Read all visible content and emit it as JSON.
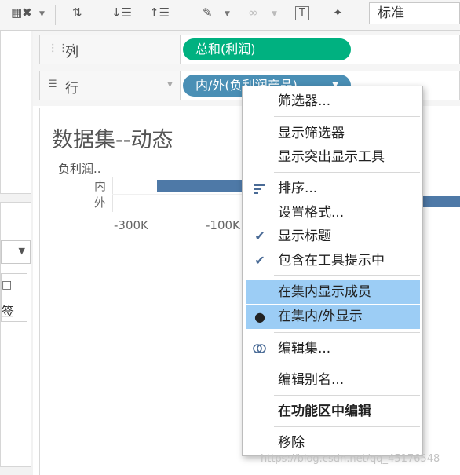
{
  "toolbar": {
    "format_select": "标准"
  },
  "shelves": {
    "columns": {
      "label": "列",
      "icon": "columns-icon",
      "pill": "总和(利润)",
      "pill_color": "#00b180"
    },
    "rows": {
      "label": "行",
      "icon": "rows-icon",
      "pill": "内/外(负利润产品)",
      "pill_color": "#4a8fb5"
    }
  },
  "left_pane": {
    "card_label": "签"
  },
  "sheet": {
    "title": "数据集--动态",
    "row_header": "负利润..",
    "row_values": [
      "内",
      "外"
    ],
    "x_ticks": [
      "-300K",
      "-100K"
    ],
    "bar_color": "#4e79a7"
  },
  "context_menu": {
    "items": [
      {
        "label": "筛选器...",
        "icon": "",
        "highlighted": false,
        "bold": false
      },
      {
        "label": "显示筛选器",
        "icon": "",
        "highlighted": false,
        "bold": false
      },
      {
        "label": "显示突出显示工具",
        "icon": "",
        "highlighted": false,
        "bold": false
      },
      {
        "label": "排序...",
        "icon": "sort-icon",
        "highlighted": false,
        "bold": false
      },
      {
        "label": "设置格式...",
        "icon": "",
        "highlighted": false,
        "bold": false
      },
      {
        "label": "显示标题",
        "icon": "checkmark-icon",
        "highlighted": false,
        "bold": false
      },
      {
        "label": "包含在工具提示中",
        "icon": "checkmark-icon",
        "highlighted": false,
        "bold": false
      },
      {
        "label": "在集内显示成员",
        "icon": "",
        "highlighted": true,
        "bold": false
      },
      {
        "label": "在集内/外显示",
        "icon": "bullet-icon",
        "highlighted": true,
        "bold": false
      },
      {
        "label": "编辑集...",
        "icon": "set-icon",
        "highlighted": false,
        "bold": false
      },
      {
        "label": "编辑别名...",
        "icon": "",
        "highlighted": false,
        "bold": false
      },
      {
        "label": "在功能区中编辑",
        "icon": "",
        "highlighted": false,
        "bold": true
      },
      {
        "label": "移除",
        "icon": "",
        "highlighted": false,
        "bold": false
      }
    ],
    "highlight_color": "#9ccdf5"
  },
  "watermark": "https://blog.csdn.net/qq_45176548"
}
